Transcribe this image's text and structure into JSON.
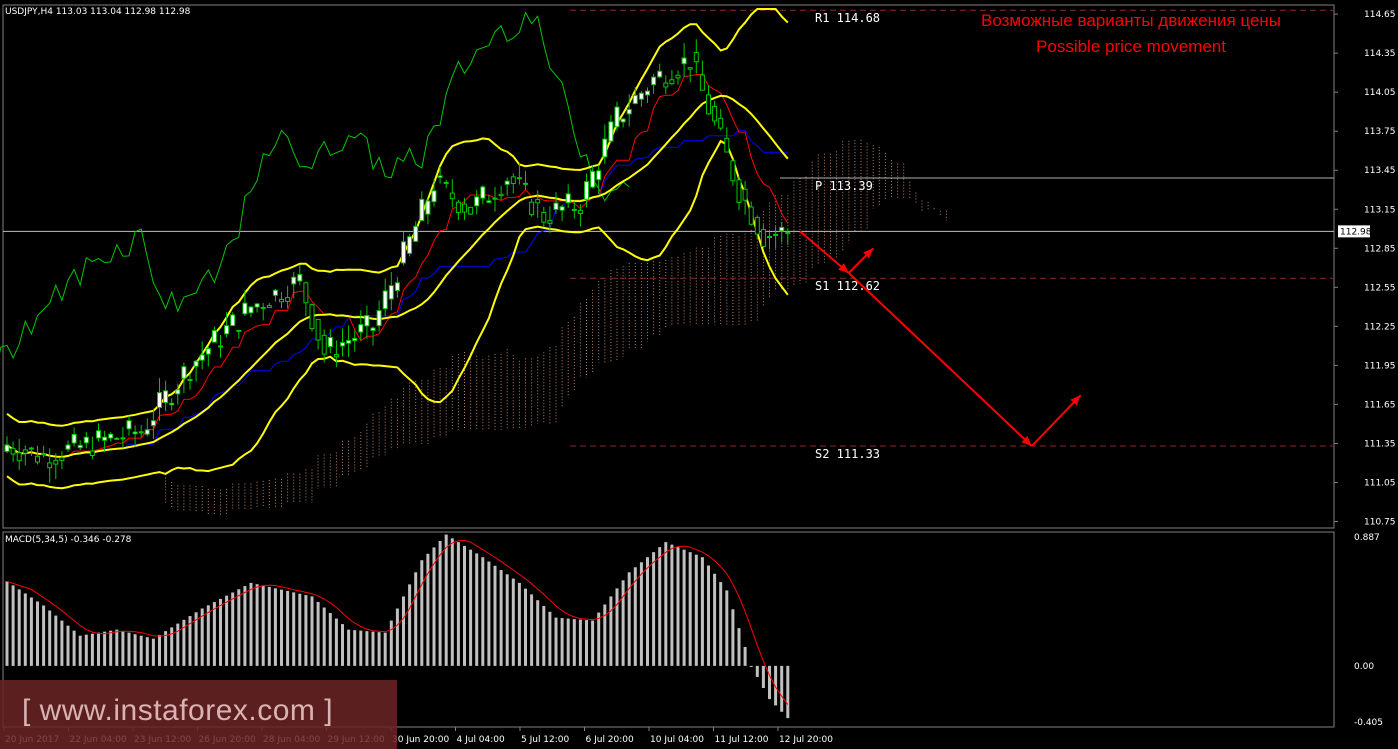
{
  "symbol_header": "USDJPY,H4  113.03 113.04 112.98 112.98",
  "annotation": {
    "line1": "Возможные варианты движения цены",
    "line2": "Possible price movement",
    "color": "#ff0000"
  },
  "levels": [
    {
      "label": "R1 114.68",
      "value": 114.68
    },
    {
      "label": "P 113.39",
      "value": 113.39
    },
    {
      "label": "S1 112.62",
      "value": 112.62
    },
    {
      "label": "S2 111.33",
      "value": 111.33
    }
  ],
  "macd_header": "MACD(5,34,5) -0.346 -0.278",
  "watermark": "[ www.instaforex.com ]",
  "colors": {
    "background": "#000000",
    "bull_candle": "#ffffff",
    "bear_candle": "#000000",
    "wick": "#00c800",
    "bollinger": "#ffff00",
    "chikou": "#00c800",
    "tenkan": "#ff0000",
    "kijun": "#0000ff",
    "cloud": "#ffb080",
    "macd_hist": "#c0c0c0",
    "macd_signal": "#ff0000",
    "level_line": "#8a2a2a",
    "price_line": "#c0c0c0",
    "arrow": "#ff0000"
  },
  "chart_data": [
    {
      "type": "candlestick",
      "title": "USDJPY,H4",
      "current_price": 112.98,
      "ylim": [
        110.7,
        114.72
      ],
      "y_ticks": [
        114.65,
        114.35,
        114.05,
        113.75,
        113.45,
        113.15,
        112.85,
        112.55,
        112.25,
        111.95,
        111.65,
        111.35,
        111.05,
        110.75
      ],
      "y_tick_labels": [
        "114.65",
        "114.35",
        "114.05",
        "113.75",
        "113.45",
        "113.15",
        "112.98",
        "112.85",
        "112.55",
        "112.25",
        "111.95",
        "111.65",
        "111.35",
        "111.05",
        "110.75"
      ],
      "x_tick_labels": [
        "20 Jun 2017",
        "22 Jun 04:00",
        "23 Jun 12:00",
        "26 Jun 20:00",
        "28 Jun 04:00",
        "29 Jun 12:00",
        "30 Jun 20:00",
        "4 Jul 04:00",
        "5 Jul 12:00",
        "6 Jul 20:00",
        "10 Jul 04:00",
        "11 Jul 12:00",
        "12 Jul 20:00"
      ],
      "anchors": [
        {
          "bar": 0,
          "close": 111.34
        },
        {
          "bar": 6,
          "close": 111.25
        },
        {
          "bar": 14,
          "close": 111.35
        },
        {
          "bar": 22,
          "close": 111.45
        },
        {
          "bar": 30,
          "close": 111.95
        },
        {
          "bar": 40,
          "close": 112.4
        },
        {
          "bar": 48,
          "close": 112.6
        },
        {
          "bar": 52,
          "close": 112.05
        },
        {
          "bar": 60,
          "close": 112.25
        },
        {
          "bar": 66,
          "close": 112.9
        },
        {
          "bar": 70,
          "close": 113.35
        },
        {
          "bar": 76,
          "close": 113.15
        },
        {
          "bar": 82,
          "close": 113.4
        },
        {
          "bar": 88,
          "close": 113.1
        },
        {
          "bar": 94,
          "close": 113.2
        },
        {
          "bar": 100,
          "close": 113.85
        },
        {
          "bar": 106,
          "close": 114.15
        },
        {
          "bar": 112,
          "close": 114.3
        },
        {
          "bar": 116,
          "close": 113.8
        },
        {
          "bar": 120,
          "close": 113.3
        },
        {
          "bar": 124,
          "close": 112.95
        },
        {
          "bar": 128,
          "close": 112.98
        }
      ],
      "bar_count": 129,
      "forecast_path": [
        {
          "bar": 130,
          "price": 112.98
        },
        {
          "bar": 138,
          "price": 112.66
        },
        {
          "bar": 142,
          "price": 112.85
        },
        {
          "bar": 138,
          "price": 112.66
        },
        {
          "bar": 168,
          "price": 111.33
        },
        {
          "bar": 176,
          "price": 111.72
        }
      ]
    },
    {
      "type": "bar",
      "title": "MACD(5,34,5)",
      "values_label": "-0.346 -0.278",
      "ylim": [
        -0.405,
        0.887
      ],
      "y_tick_labels": [
        "0.887",
        "0.00",
        "-0.405"
      ],
      "anchors": [
        {
          "bar": 0,
          "value": 0.56
        },
        {
          "bar": 6,
          "value": 0.4
        },
        {
          "bar": 12,
          "value": 0.2
        },
        {
          "bar": 18,
          "value": 0.24
        },
        {
          "bar": 24,
          "value": 0.18
        },
        {
          "bar": 32,
          "value": 0.38
        },
        {
          "bar": 40,
          "value": 0.55
        },
        {
          "bar": 50,
          "value": 0.46
        },
        {
          "bar": 56,
          "value": 0.24
        },
        {
          "bar": 62,
          "value": 0.22
        },
        {
          "bar": 68,
          "value": 0.7
        },
        {
          "bar": 72,
          "value": 0.87
        },
        {
          "bar": 78,
          "value": 0.72
        },
        {
          "bar": 84,
          "value": 0.55
        },
        {
          "bar": 90,
          "value": 0.32
        },
        {
          "bar": 96,
          "value": 0.3
        },
        {
          "bar": 102,
          "value": 0.62
        },
        {
          "bar": 108,
          "value": 0.82
        },
        {
          "bar": 114,
          "value": 0.72
        },
        {
          "bar": 118,
          "value": 0.5
        },
        {
          "bar": 122,
          "value": 0.0
        },
        {
          "bar": 125,
          "value": -0.22
        },
        {
          "bar": 128,
          "value": -0.346
        }
      ],
      "signal_last": -0.278
    }
  ]
}
